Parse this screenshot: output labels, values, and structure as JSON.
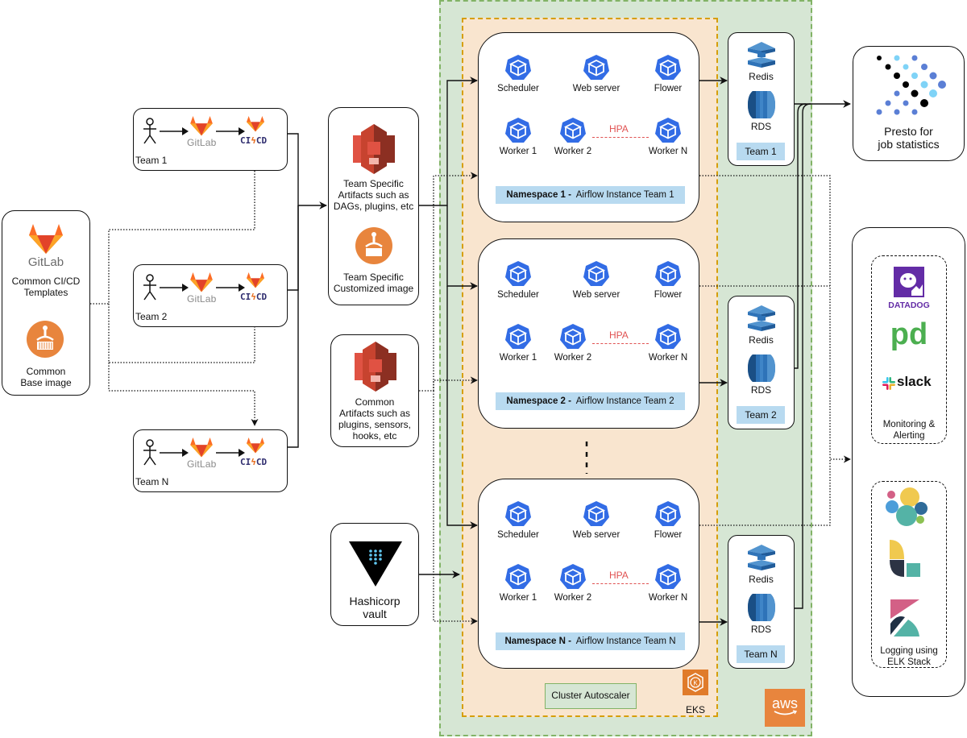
{
  "common": {
    "gitlab_word": "GitLab",
    "templates_label": "Common CI/CD\nTemplates",
    "base_image_label": "Common\nBase image"
  },
  "teams": [
    {
      "name": "Team 1",
      "gitlab": "GitLab",
      "cicd_left": "CI",
      "cicd_right": "CD"
    },
    {
      "name": "Team 2",
      "gitlab": "GitLab",
      "cicd_left": "CI",
      "cicd_right": "CD"
    },
    {
      "name": "Team N",
      "gitlab": "GitLab",
      "cicd_left": "CI",
      "cicd_right": "CD"
    }
  ],
  "artifacts": {
    "team_specific_label": "Team Specific\nArtifacts such as\nDAGs, plugins, etc",
    "team_image_label": "Team Specific\nCustomized image",
    "common_label": "Common\nArtifacts such as\nplugins, sensors,\nhooks, etc",
    "vault_label": "Hashicorp\nvault"
  },
  "namespaces": [
    {
      "title": "Namespace 1 -",
      "subtitle": "Airflow Instance Team 1",
      "pods": [
        "Scheduler",
        "Web server",
        "Flower",
        "Worker 1",
        "Worker 2",
        "Worker N"
      ],
      "hpa": "HPA"
    },
    {
      "title": "Namespace 2 -",
      "subtitle": "Airflow Instance Team 2",
      "pods": [
        "Scheduler",
        "Web server",
        "Flower",
        "Worker 1",
        "Worker 2",
        "Worker N"
      ],
      "hpa": "HPA"
    },
    {
      "title": "Namespace N -",
      "subtitle": "Airflow Instance Team N",
      "pods": [
        "Scheduler",
        "Web server",
        "Flower",
        "Worker 1",
        "Worker 2",
        "Worker N"
      ],
      "hpa": "HPA"
    }
  ],
  "datastores": [
    {
      "redis": "Redis",
      "rds": "RDS",
      "team": "Team 1"
    },
    {
      "redis": "Redis",
      "rds": "RDS",
      "team": "Team 2"
    },
    {
      "redis": "Redis",
      "rds": "RDS",
      "team": "Team N"
    }
  ],
  "cluster": {
    "autoscaler": "Cluster Autoscaler",
    "eks": "EKS",
    "aws": "aws"
  },
  "presto": {
    "label": "Presto for\njob statistics"
  },
  "monitoring": {
    "datadog": "DATADOG",
    "pagerduty": "pd",
    "slack": "slack",
    "label": "Monitoring &\nAlerting"
  },
  "logging": {
    "label": "Logging using\nELK Stack"
  },
  "colors": {
    "aws_region": "#d6e6d4",
    "aws_border": "#82b366",
    "eks_region": "#fbe5cf",
    "eks_border": "#d79b00",
    "k8s_blue": "#326ce5",
    "namespace_bar": "#b8daf0",
    "hpa": "#e05252",
    "gitlab_orange": "#e24329",
    "aws_orange": "#e8853d",
    "s3_red": "#c7432f"
  }
}
